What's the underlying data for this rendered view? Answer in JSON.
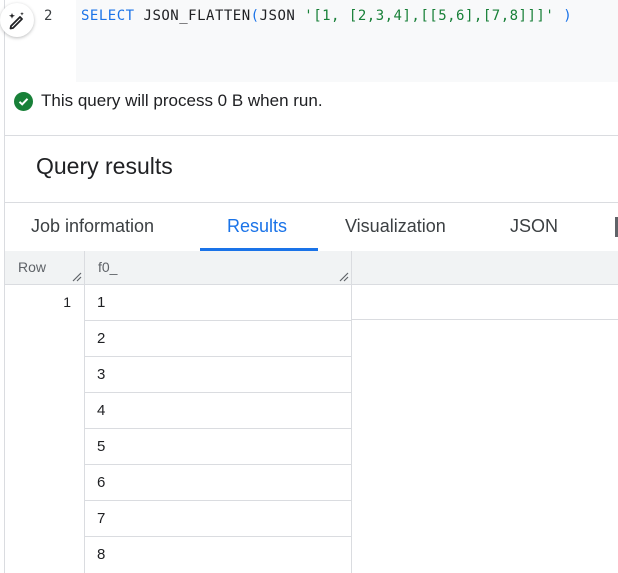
{
  "editor": {
    "line_number": "2",
    "code": {
      "keyword": "SELECT",
      "function": "JSON_FLATTEN",
      "open_paren": "(",
      "type_kw": "JSON",
      "literal": "'[1, [2,3,4],[[5,6],[7,8]]]'",
      "close_paren": ")"
    }
  },
  "status": {
    "icon": "check-circle-icon",
    "text": "This query will process 0 B when run."
  },
  "results": {
    "title": "Query results"
  },
  "tabs": [
    {
      "label": "Job information"
    },
    {
      "label": "Results",
      "active": true
    },
    {
      "label": "Visualization"
    },
    {
      "label": "JSON"
    }
  ],
  "table": {
    "headers": {
      "row": "Row",
      "col": "f0_"
    },
    "row_number": "1",
    "values": [
      "1",
      "2",
      "3",
      "4",
      "5",
      "6",
      "7",
      "8"
    ]
  },
  "colors": {
    "accent": "#1a73e8",
    "success": "#188038"
  }
}
